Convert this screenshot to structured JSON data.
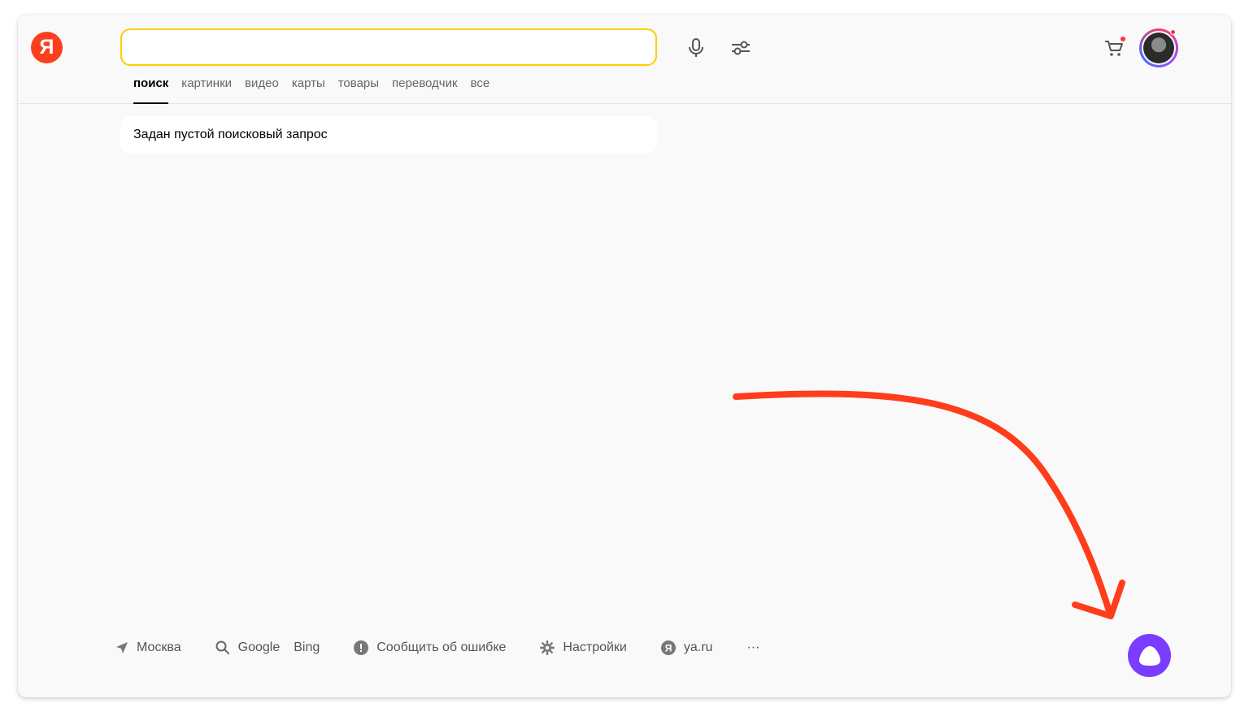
{
  "logo": {
    "letter": "Я"
  },
  "search": {
    "value": "",
    "placeholder": ""
  },
  "tabs": [
    {
      "label": "поиск",
      "active": true
    },
    {
      "label": "картинки",
      "active": false
    },
    {
      "label": "видео",
      "active": false
    },
    {
      "label": "карты",
      "active": false
    },
    {
      "label": "товары",
      "active": false
    },
    {
      "label": "переводчик",
      "active": false
    },
    {
      "label": "все",
      "active": false
    }
  ],
  "notice": {
    "text": "Задан пустой поисковый запрос"
  },
  "footer": {
    "location": "Москва",
    "engines": [
      "Google",
      "Bing"
    ],
    "report": "Сообщить об ошибке",
    "settings": "Настройки",
    "yaru": "ya.ru",
    "more": "···"
  },
  "colors": {
    "accent": "#ffcc00",
    "brand": "#fc3f1d",
    "alice": "#7a3cff",
    "annotation_arrow": "#ff3d1a"
  },
  "icons": [
    "microphone-icon",
    "filters-icon",
    "cart-icon",
    "location-arrow-icon",
    "search-icon",
    "alert-icon",
    "gear-icon",
    "yandex-icon",
    "alice-icon"
  ]
}
